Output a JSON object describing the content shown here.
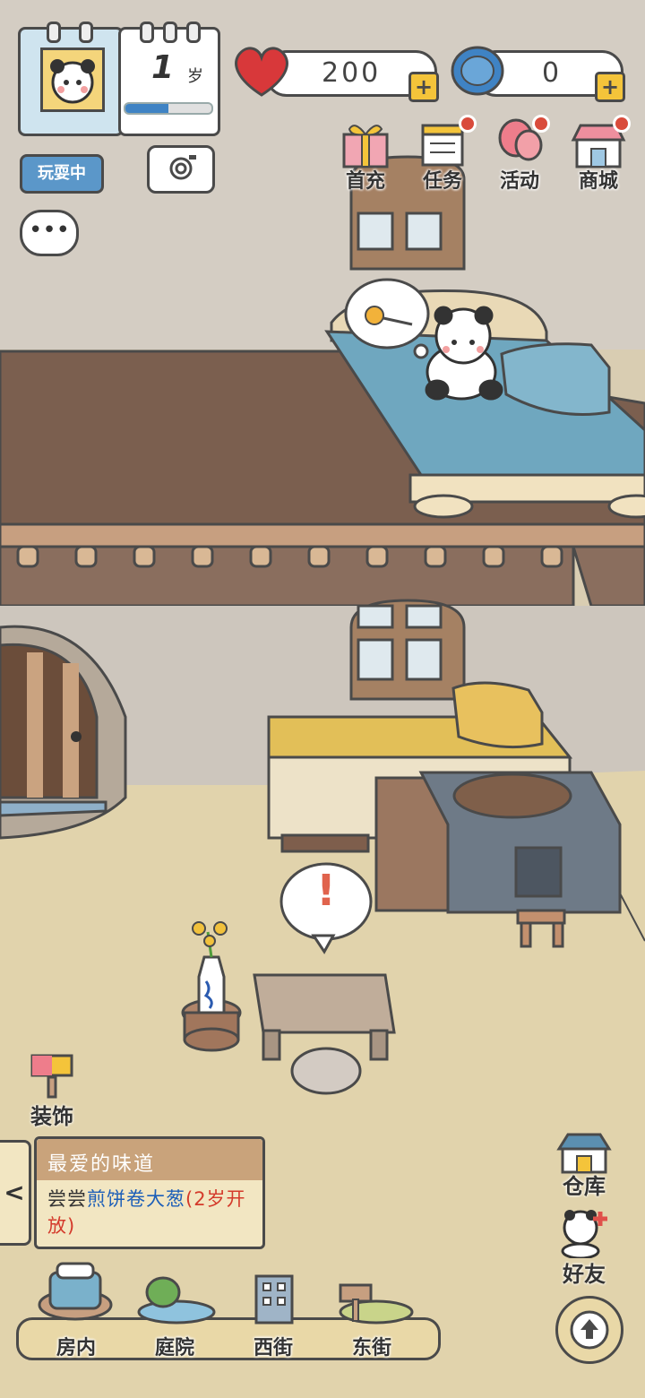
{
  "player": {
    "age_number": "1",
    "age_unit": "岁",
    "age_progress": 0.5
  },
  "status": {
    "label": "玩耍中"
  },
  "currencies": {
    "hearts": "200",
    "coins": "0"
  },
  "menu": [
    {
      "label": "首充",
      "icon": "gift-icon",
      "dot": false
    },
    {
      "label": "任务",
      "icon": "task-calendar-icon",
      "dot": true
    },
    {
      "label": "活动",
      "icon": "balloon-icon",
      "dot": true
    },
    {
      "label": "商城",
      "icon": "shop-icon",
      "dot": true
    }
  ],
  "thought_bubble": {
    "icon": "candy-stick-icon"
  },
  "alert_bubble": {
    "text": "!"
  },
  "decorate": {
    "label": "装饰"
  },
  "quest": {
    "title": "最爱的味道",
    "desc_prefix": "尝尝",
    "desc_item": "煎饼卷大葱",
    "desc_note": "(2岁开放)",
    "collapse_glyph": "<"
  },
  "right_buttons": {
    "warehouse": "仓库",
    "friends": "好友"
  },
  "nav": [
    {
      "label": "房内",
      "icon": "bed-icon"
    },
    {
      "label": "庭院",
      "icon": "garden-icon"
    },
    {
      "label": "西街",
      "icon": "building-icon"
    },
    {
      "label": "东街",
      "icon": "signpost-icon"
    }
  ],
  "colors": {
    "item_blue": "#1d5fb8",
    "note_red": "#d43a2b",
    "heart_red": "#d8383a",
    "coin_blue": "#3f83c4",
    "bed_blue": "#7ab1cb"
  }
}
